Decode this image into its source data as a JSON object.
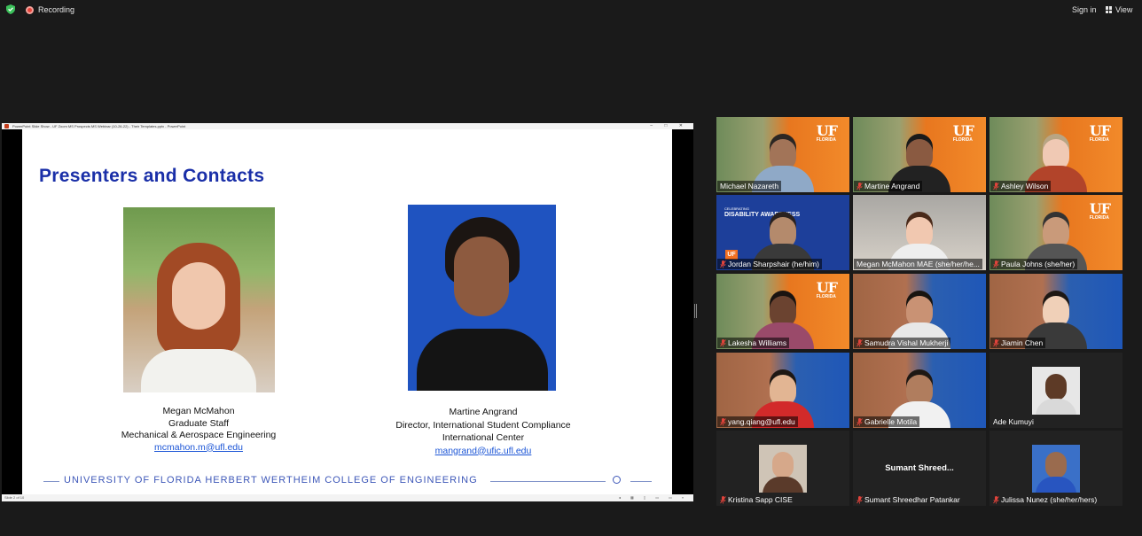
{
  "topbar": {
    "recording_label": "Recording",
    "signin_label": "Sign in",
    "view_label": "View",
    "shield_color": "#3cc15b",
    "recording_color": "#e8453c"
  },
  "share": {
    "window_title": "PowerPoint Slide Show - UF Zoom MS Prospects MS Webinar (10-26-22) - Their Templates.pptx - PowerPoint",
    "window_buttons": "– □ ✕",
    "status_left": "Slide 2 of 10",
    "status_right": "◂ ▦ ▯ ▭ ▭ ▿",
    "slide": {
      "title": "Presenters and Contacts",
      "presenter1": {
        "name": "Megan McMahon",
        "role": "Graduate Staff",
        "dept": "Mechanical & Aerospace Engineering",
        "email": "mcmahon.m@ufl.edu"
      },
      "presenter2": {
        "name": "Martine Angrand",
        "role": "Director, International Student Compliance",
        "dept": "International Center",
        "email": "mangrand@ufic.ufl.edu"
      },
      "footer": "UNIVERSITY OF FLORIDA HERBERT WERTHEIM COLLEGE OF ENGINEERING",
      "title_color": "#1a2fa8"
    }
  },
  "gallery": {
    "tiles": [
      {
        "name": "Michael Nazareth",
        "muted": false
      },
      {
        "name": "Martine Angrand",
        "muted": true
      },
      {
        "name": "Ashley Wilson",
        "muted": true
      },
      {
        "name": "Jordan Sharpshair (he/him)",
        "muted": true,
        "bg_heading": "DISABILITY AWARENESS",
        "bg_kicker": "CELEBRATING",
        "bg_badge": "UF"
      },
      {
        "name": "Megan McMahon MAE (she/her/he...",
        "muted": false,
        "speaking": true
      },
      {
        "name": "Paula Johns (she/her)",
        "muted": true
      },
      {
        "name": "Lakesha Williams",
        "muted": true
      },
      {
        "name": "Samudra Vishal Mukherji",
        "muted": true
      },
      {
        "name": "Jiamin Chen",
        "muted": true
      },
      {
        "name": "yang.qiang@ufl.edu",
        "muted": true
      },
      {
        "name": "Gabrielle Motila",
        "muted": true
      },
      {
        "name": "Ade Kumuyi",
        "muted": false
      },
      {
        "name": "Kristina Sapp CISE",
        "muted": true
      },
      {
        "name": "Sumant Shreedhar Patankar",
        "muted": true,
        "display_title": "Sumant  Shreed..."
      },
      {
        "name": "Julissa Nunez (she/her/hers)",
        "muted": true
      }
    ],
    "uf_logo_text": "UF",
    "uf_logo_sub": "FLORIDA",
    "speaking_color": "#c5d62b"
  }
}
